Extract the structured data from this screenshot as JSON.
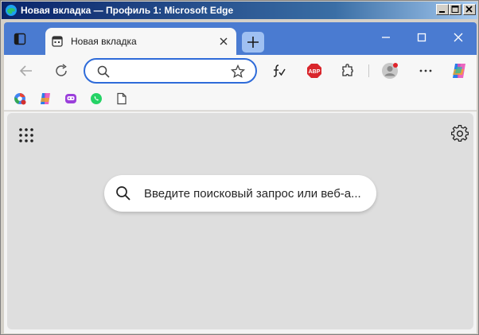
{
  "window": {
    "title": "Новая вкладка — Профиль 1: Microsoft Edge"
  },
  "tabs": [
    {
      "title": "Новая вкладка",
      "active": true
    }
  ],
  "address_bar": {
    "value": "",
    "placeholder": ""
  },
  "favorites": [
    {
      "icon": "google-chrome-remote-icon"
    },
    {
      "icon": "copilot-icon"
    },
    {
      "icon": "bot-icon"
    },
    {
      "icon": "whatsapp-icon"
    },
    {
      "icon": "document-icon"
    }
  ],
  "toolbar": {
    "adblock_label": "ABP"
  },
  "new_tab_page": {
    "search_placeholder": "Введите поисковый запрос или веб-а..."
  },
  "colors": {
    "tabstrip": "#4a7bd1",
    "accent": "#2e6bd9",
    "page_background": "#dedede"
  }
}
